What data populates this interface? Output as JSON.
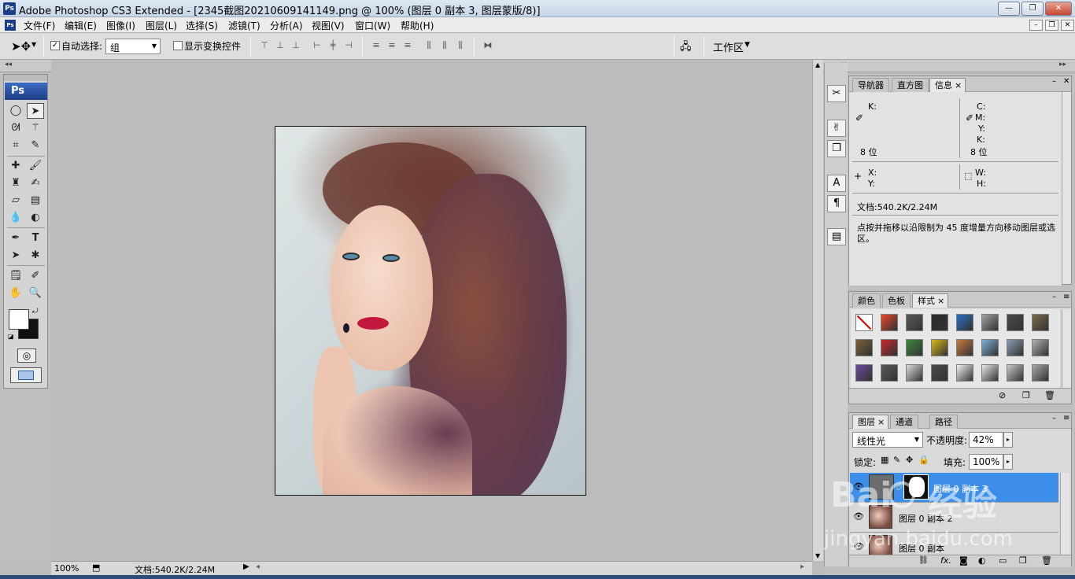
{
  "window": {
    "title": "Adobe Photoshop CS3 Extended - [2345截图20210609141149.png @ 100% (图层 0 副本 3, 图层蒙版/8)]",
    "logo": "Ps"
  },
  "menu": [
    "文件(F)",
    "编辑(E)",
    "图像(I)",
    "图层(L)",
    "选择(S)",
    "滤镜(T)",
    "分析(A)",
    "视图(V)",
    "窗口(W)",
    "帮助(H)"
  ],
  "options": {
    "auto_select_label": "自动选择:",
    "auto_select_value": "组",
    "show_transform_label": "显示变换控件",
    "workspace_label": "工作区"
  },
  "status": {
    "zoom": "100%",
    "doc_size": "文档:540.2K/2.24M"
  },
  "info_panel": {
    "tabs": [
      "导航器",
      "直方图",
      "信息"
    ],
    "k_label": "K:",
    "c_label": "C:",
    "m_label": "M:",
    "y_label": "Y:",
    "k2_label": "K:",
    "bit_left": "8 位",
    "bit_right": "8 位",
    "x_label": "X:",
    "y2_label": "Y:",
    "w_label": "W:",
    "h_label": "H:",
    "doc_size": "文档:540.2K/2.24M",
    "hint": "点按并拖移以沿限制为 45 度增量方向移动图层或选区。"
  },
  "styles_panel": {
    "tabs": [
      "颜色",
      "色板",
      "样式"
    ],
    "swatch_colors": [
      "#ffffff",
      "#e8462a",
      "#5a5a5a",
      "#2a2a2a",
      "#2a6fbd",
      "#a0a0a0",
      "#4a4a4a",
      "#7a6a4a",
      "#7a6038",
      "#c82a2a",
      "#3a8a3a",
      "#d8b818",
      "#c87a40",
      "#7ab0d8",
      "#8a9ab0",
      "#b0b0b0",
      "#6a4a9a",
      "#5a5a5a",
      "#dcdcdc",
      "#4a4a4a",
      "#f2f2f2",
      "#e8e8e8",
      "#c8c8c8",
      "#a8a8a8"
    ]
  },
  "layers_panel": {
    "tabs": [
      "图层",
      "通道",
      "路径"
    ],
    "blend_mode": "线性光",
    "opacity_label": "不透明度:",
    "opacity_value": "42%",
    "lock_label": "锁定:",
    "fill_label": "填充:",
    "fill_value": "100%",
    "layers": [
      {
        "name": "图层 0 副本 3",
        "selected": true
      },
      {
        "name": "图层 0 副本 2",
        "selected": false
      },
      {
        "name": "图层 0 副本",
        "selected": false
      }
    ]
  },
  "watermark": {
    "brand": "Bai",
    "brand2": "经验",
    "url": "jingyan.baidu.com"
  }
}
